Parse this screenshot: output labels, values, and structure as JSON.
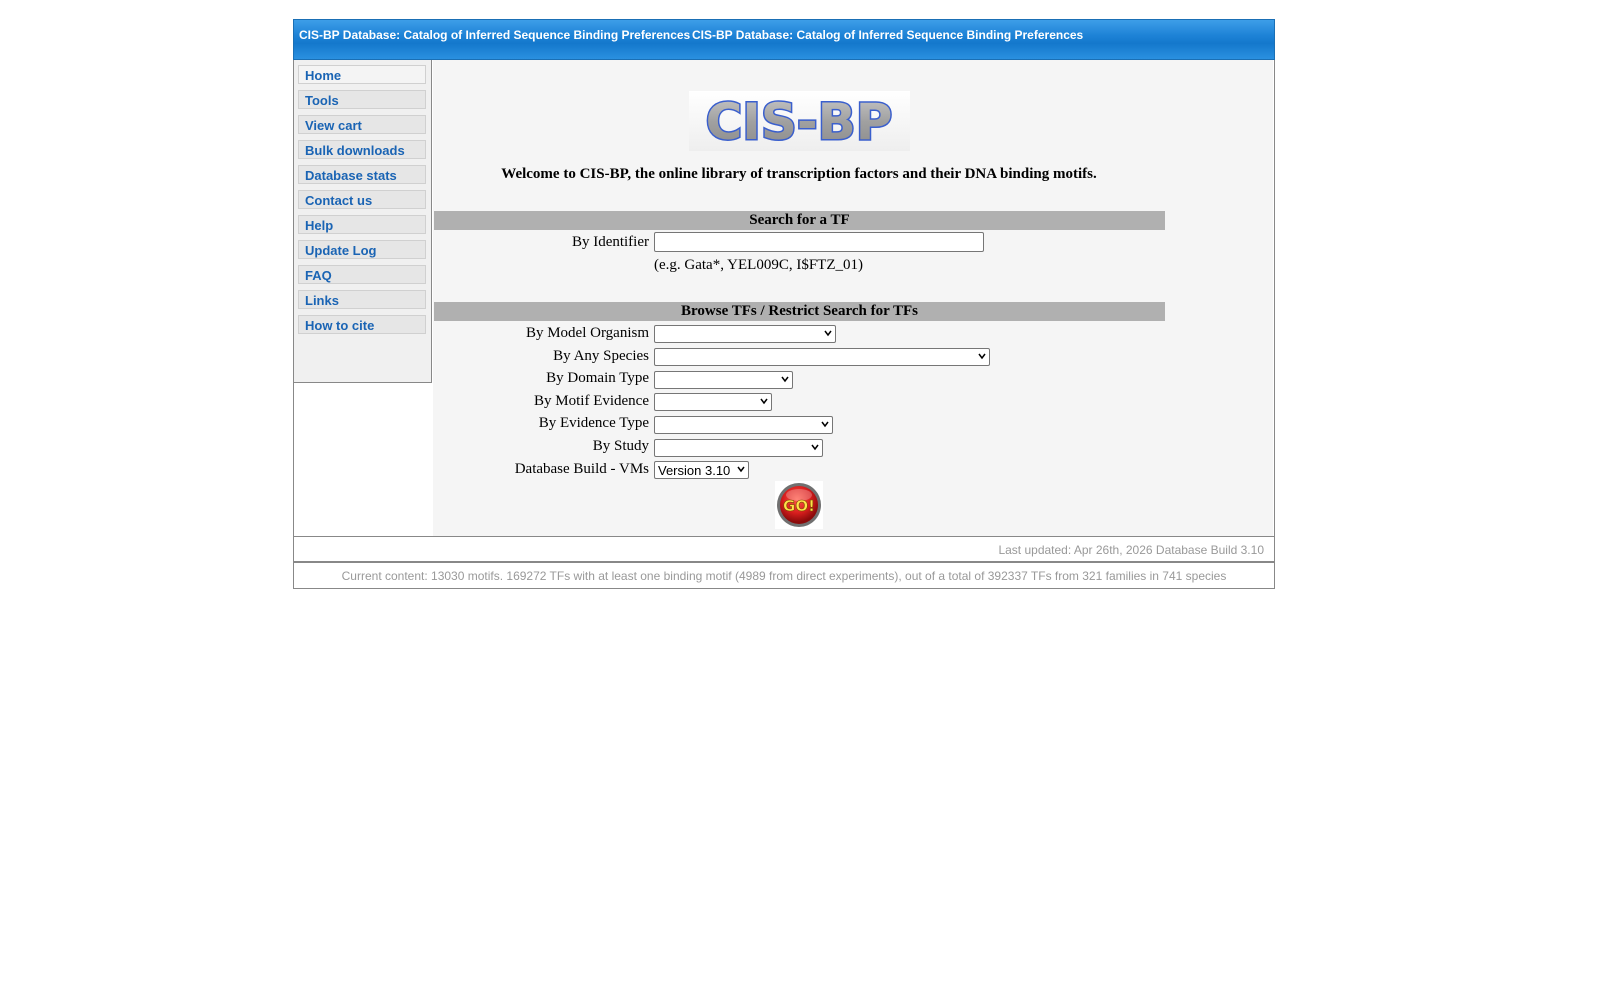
{
  "titlebar": {
    "text_left": "CIS-BP Database: Catalog of Inferred Sequence Binding Preferences",
    "text_right": "CIS-BP Database: Catalog of Inferred Sequence Binding Preferences"
  },
  "sidebar": {
    "items": [
      {
        "label": "Home"
      },
      {
        "label": "Tools"
      },
      {
        "label": "View cart"
      },
      {
        "label": "Bulk downloads"
      },
      {
        "label": "Database stats"
      },
      {
        "label": "Contact us"
      },
      {
        "label": "Help"
      },
      {
        "label": "Update Log"
      },
      {
        "label": "FAQ"
      },
      {
        "label": "Links"
      },
      {
        "label": "How to cite"
      }
    ]
  },
  "logo": {
    "text": "CIS-BP"
  },
  "welcome": "Welcome to CIS-BP, the online library of transcription factors and their DNA binding motifs.",
  "search_section": {
    "heading": "Search for a TF",
    "identifier_label": "By Identifier",
    "identifier_value": "",
    "example": "(e.g. Gata*, YEL009C, I$FTZ_01)"
  },
  "browse_section": {
    "heading": "Browse TFs / Restrict Search for TFs",
    "filters": [
      {
        "label": "By Model Organism",
        "value": ""
      },
      {
        "label": "By Any Species",
        "value": ""
      },
      {
        "label": "By Domain Type",
        "value": ""
      },
      {
        "label": "By Motif Evidence",
        "value": ""
      },
      {
        "label": "By Evidence Type",
        "value": ""
      },
      {
        "label": "By Study",
        "value": ""
      },
      {
        "label": "Database Build - VMs",
        "value": "Version 3.10"
      }
    ],
    "go_label": "GO!"
  },
  "footer": {
    "last_updated": "Last updated: Apr 26th, 2026 Database Build 3.10",
    "content_summary": "Current content: 13030 motifs. 169272 TFs with at least one binding motif (4989 from direct experiments), out of a total of 392337 TFs from 321 families in 741 species"
  },
  "colors": {
    "titlebar_blue": "#1d82d6",
    "nav_link": "#1a64b4",
    "section_bar": "#b0b0b0",
    "go_red": "#d81e1e"
  }
}
